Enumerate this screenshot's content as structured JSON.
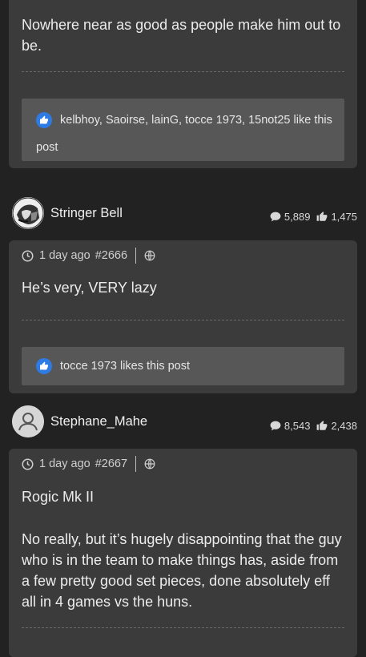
{
  "post_prev": {
    "text": "Nowhere near as good as people make him out to be.",
    "likes_text": "kelbhoy, Saoirse, lainG, tocce 1973, 15not25 like this post"
  },
  "author1": {
    "name": "Stringer Bell",
    "posts_count": "5,889",
    "likes_count": "1,475"
  },
  "post1": {
    "time": "1 day ago",
    "number": "#2666",
    "text": "He’s very, VERY lazy",
    "likes_text": "tocce 1973 likes this post"
  },
  "author2": {
    "name": "Stephane_Mahe",
    "posts_count": "8,543",
    "likes_count": "2,438"
  },
  "post2": {
    "time": "1 day ago",
    "number": "#2667",
    "text_p1": "Rogic Mk II",
    "text_p2": "No really, but it’s hugely disappointing that the guy who is in the team to make things has, aside from a few pretty good set pieces, done absolutely eff all in 4 games vs the huns."
  },
  "colors": {
    "background": "#222222",
    "card": "#3b3b3b",
    "likes_box": "#575757",
    "like_badge": "#2e7be4"
  },
  "icons": [
    "clock-icon",
    "globe-icon",
    "comment-icon",
    "thumbs-up-icon",
    "like-badge-icon",
    "default-avatar-icon"
  ]
}
